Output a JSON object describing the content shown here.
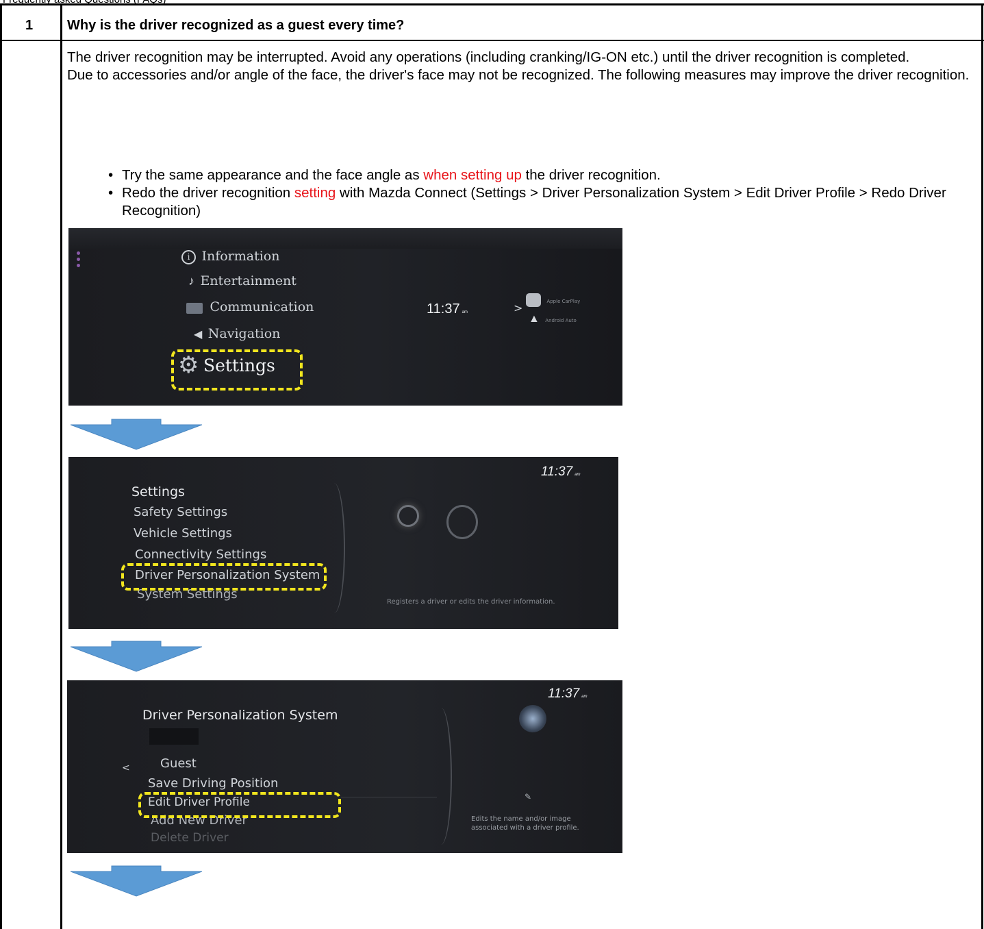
{
  "header_cut": "Frequently asked Questions (FAQs)",
  "row": {
    "number": "1",
    "question": "Why is the driver recognized as a guest every time?"
  },
  "answer": {
    "para1": "The driver recognition may be interrupted. Avoid any operations (including cranking/IG-ON etc.) until the driver recognition is completed.",
    "para2": "Due to accessories and/or angle of the face, the driver's face may not be recognized. The following measures may improve the driver recognition.",
    "tip1_a": "Try the same appearance and the face angle as ",
    "tip1_red": "when setting up",
    "tip1_b": " the driver recognition.",
    "tip2_a": "Redo the driver recognition ",
    "tip2_red": "setting",
    "tip2_b": " with Mazda Connect (Settings > Driver Personalization System > Edit Driver Profile > Redo Driver Recognition)",
    "bullet": "•"
  },
  "screen1": {
    "menu": [
      "Information",
      "Entertainment",
      "Communication",
      "Navigation",
      "Settings"
    ],
    "time": "11:37",
    "ampm": "am",
    "carplay": "Apple CarPlay",
    "android": "Android Auto",
    "chevron": ">"
  },
  "screen2": {
    "time": "11:37",
    "ampm": "am",
    "title": "Settings",
    "items": [
      "Safety Settings",
      "Vehicle Settings",
      "Connectivity Settings",
      "Driver Personalization System",
      "System Settings"
    ],
    "description": "Registers a driver or edits the driver information."
  },
  "screen3": {
    "time": "11:37",
    "ampm": "am",
    "title": "Driver Personalization System",
    "items": [
      "Guest",
      "Save Driving Position",
      "Edit Driver Profile",
      "Add New Driver",
      "Delete Driver"
    ],
    "back": "<",
    "description": "Edits the name and/or image associated with a driver profile."
  },
  "colors": {
    "highlight": "#f1e51e",
    "red_text": "#e8141a",
    "arrow_fill": "#5b9bd5"
  },
  "icons": [
    "info-icon",
    "music-note-icon",
    "chat-icon",
    "navigation-icon",
    "gear-icon",
    "carplay-icon",
    "android-auto-icon",
    "down-arrow-icon"
  ]
}
